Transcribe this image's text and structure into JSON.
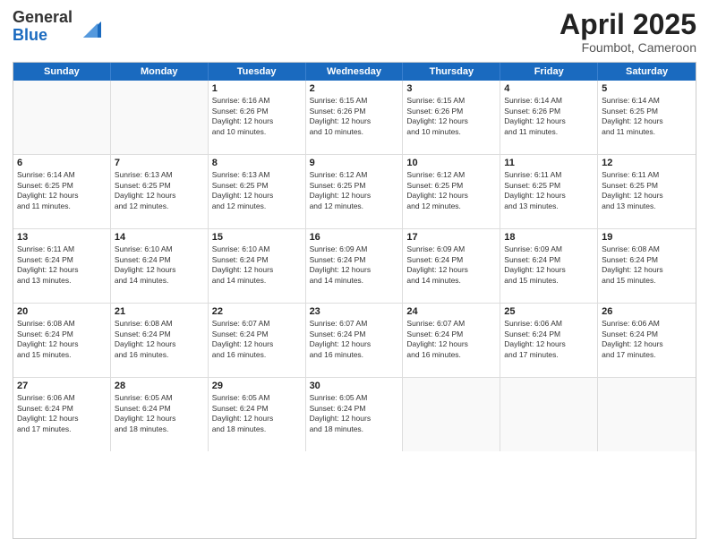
{
  "logo": {
    "general": "General",
    "blue": "Blue"
  },
  "title": "April 2025",
  "location": "Foumbot, Cameroon",
  "days": [
    "Sunday",
    "Monday",
    "Tuesday",
    "Wednesday",
    "Thursday",
    "Friday",
    "Saturday"
  ],
  "rows": [
    [
      {
        "day": "",
        "lines": []
      },
      {
        "day": "",
        "lines": []
      },
      {
        "day": "1",
        "lines": [
          "Sunrise: 6:16 AM",
          "Sunset: 6:26 PM",
          "Daylight: 12 hours",
          "and 10 minutes."
        ]
      },
      {
        "day": "2",
        "lines": [
          "Sunrise: 6:15 AM",
          "Sunset: 6:26 PM",
          "Daylight: 12 hours",
          "and 10 minutes."
        ]
      },
      {
        "day": "3",
        "lines": [
          "Sunrise: 6:15 AM",
          "Sunset: 6:26 PM",
          "Daylight: 12 hours",
          "and 10 minutes."
        ]
      },
      {
        "day": "4",
        "lines": [
          "Sunrise: 6:14 AM",
          "Sunset: 6:26 PM",
          "Daylight: 12 hours",
          "and 11 minutes."
        ]
      },
      {
        "day": "5",
        "lines": [
          "Sunrise: 6:14 AM",
          "Sunset: 6:25 PM",
          "Daylight: 12 hours",
          "and 11 minutes."
        ]
      }
    ],
    [
      {
        "day": "6",
        "lines": [
          "Sunrise: 6:14 AM",
          "Sunset: 6:25 PM",
          "Daylight: 12 hours",
          "and 11 minutes."
        ]
      },
      {
        "day": "7",
        "lines": [
          "Sunrise: 6:13 AM",
          "Sunset: 6:25 PM",
          "Daylight: 12 hours",
          "and 12 minutes."
        ]
      },
      {
        "day": "8",
        "lines": [
          "Sunrise: 6:13 AM",
          "Sunset: 6:25 PM",
          "Daylight: 12 hours",
          "and 12 minutes."
        ]
      },
      {
        "day": "9",
        "lines": [
          "Sunrise: 6:12 AM",
          "Sunset: 6:25 PM",
          "Daylight: 12 hours",
          "and 12 minutes."
        ]
      },
      {
        "day": "10",
        "lines": [
          "Sunrise: 6:12 AM",
          "Sunset: 6:25 PM",
          "Daylight: 12 hours",
          "and 12 minutes."
        ]
      },
      {
        "day": "11",
        "lines": [
          "Sunrise: 6:11 AM",
          "Sunset: 6:25 PM",
          "Daylight: 12 hours",
          "and 13 minutes."
        ]
      },
      {
        "day": "12",
        "lines": [
          "Sunrise: 6:11 AM",
          "Sunset: 6:25 PM",
          "Daylight: 12 hours",
          "and 13 minutes."
        ]
      }
    ],
    [
      {
        "day": "13",
        "lines": [
          "Sunrise: 6:11 AM",
          "Sunset: 6:24 PM",
          "Daylight: 12 hours",
          "and 13 minutes."
        ]
      },
      {
        "day": "14",
        "lines": [
          "Sunrise: 6:10 AM",
          "Sunset: 6:24 PM",
          "Daylight: 12 hours",
          "and 14 minutes."
        ]
      },
      {
        "day": "15",
        "lines": [
          "Sunrise: 6:10 AM",
          "Sunset: 6:24 PM",
          "Daylight: 12 hours",
          "and 14 minutes."
        ]
      },
      {
        "day": "16",
        "lines": [
          "Sunrise: 6:09 AM",
          "Sunset: 6:24 PM",
          "Daylight: 12 hours",
          "and 14 minutes."
        ]
      },
      {
        "day": "17",
        "lines": [
          "Sunrise: 6:09 AM",
          "Sunset: 6:24 PM",
          "Daylight: 12 hours",
          "and 14 minutes."
        ]
      },
      {
        "day": "18",
        "lines": [
          "Sunrise: 6:09 AM",
          "Sunset: 6:24 PM",
          "Daylight: 12 hours",
          "and 15 minutes."
        ]
      },
      {
        "day": "19",
        "lines": [
          "Sunrise: 6:08 AM",
          "Sunset: 6:24 PM",
          "Daylight: 12 hours",
          "and 15 minutes."
        ]
      }
    ],
    [
      {
        "day": "20",
        "lines": [
          "Sunrise: 6:08 AM",
          "Sunset: 6:24 PM",
          "Daylight: 12 hours",
          "and 15 minutes."
        ]
      },
      {
        "day": "21",
        "lines": [
          "Sunrise: 6:08 AM",
          "Sunset: 6:24 PM",
          "Daylight: 12 hours",
          "and 16 minutes."
        ]
      },
      {
        "day": "22",
        "lines": [
          "Sunrise: 6:07 AM",
          "Sunset: 6:24 PM",
          "Daylight: 12 hours",
          "and 16 minutes."
        ]
      },
      {
        "day": "23",
        "lines": [
          "Sunrise: 6:07 AM",
          "Sunset: 6:24 PM",
          "Daylight: 12 hours",
          "and 16 minutes."
        ]
      },
      {
        "day": "24",
        "lines": [
          "Sunrise: 6:07 AM",
          "Sunset: 6:24 PM",
          "Daylight: 12 hours",
          "and 16 minutes."
        ]
      },
      {
        "day": "25",
        "lines": [
          "Sunrise: 6:06 AM",
          "Sunset: 6:24 PM",
          "Daylight: 12 hours",
          "and 17 minutes."
        ]
      },
      {
        "day": "26",
        "lines": [
          "Sunrise: 6:06 AM",
          "Sunset: 6:24 PM",
          "Daylight: 12 hours",
          "and 17 minutes."
        ]
      }
    ],
    [
      {
        "day": "27",
        "lines": [
          "Sunrise: 6:06 AM",
          "Sunset: 6:24 PM",
          "Daylight: 12 hours",
          "and 17 minutes."
        ]
      },
      {
        "day": "28",
        "lines": [
          "Sunrise: 6:05 AM",
          "Sunset: 6:24 PM",
          "Daylight: 12 hours",
          "and 18 minutes."
        ]
      },
      {
        "day": "29",
        "lines": [
          "Sunrise: 6:05 AM",
          "Sunset: 6:24 PM",
          "Daylight: 12 hours",
          "and 18 minutes."
        ]
      },
      {
        "day": "30",
        "lines": [
          "Sunrise: 6:05 AM",
          "Sunset: 6:24 PM",
          "Daylight: 12 hours",
          "and 18 minutes."
        ]
      },
      {
        "day": "",
        "lines": []
      },
      {
        "day": "",
        "lines": []
      },
      {
        "day": "",
        "lines": []
      }
    ]
  ]
}
